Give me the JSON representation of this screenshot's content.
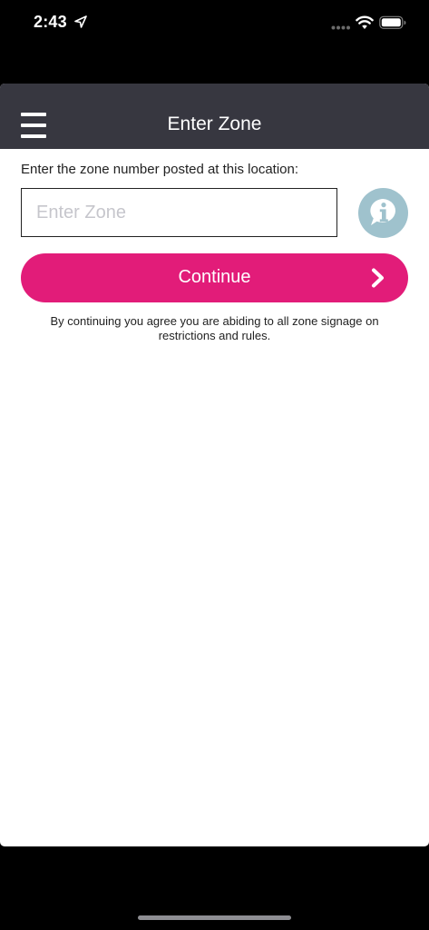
{
  "status_bar": {
    "time": "2:43"
  },
  "nav": {
    "title": "Enter Zone",
    "menu_icon": "hamburger-menu-icon"
  },
  "zone_entry": {
    "prompt": "Enter the zone number posted at this location:",
    "input_value": "",
    "input_placeholder": "Enter Zone",
    "info_icon": "info-speech-bubble-icon"
  },
  "continue_button": {
    "label": "Continue",
    "icon": "chevron-right-icon"
  },
  "disclaimer": "By continuing you agree you are abiding to all zone signage on restrictions and rules.",
  "colors": {
    "nav_background": "#373740",
    "accent": "#e21c79",
    "info_icon_background": "#9fc2cd"
  }
}
